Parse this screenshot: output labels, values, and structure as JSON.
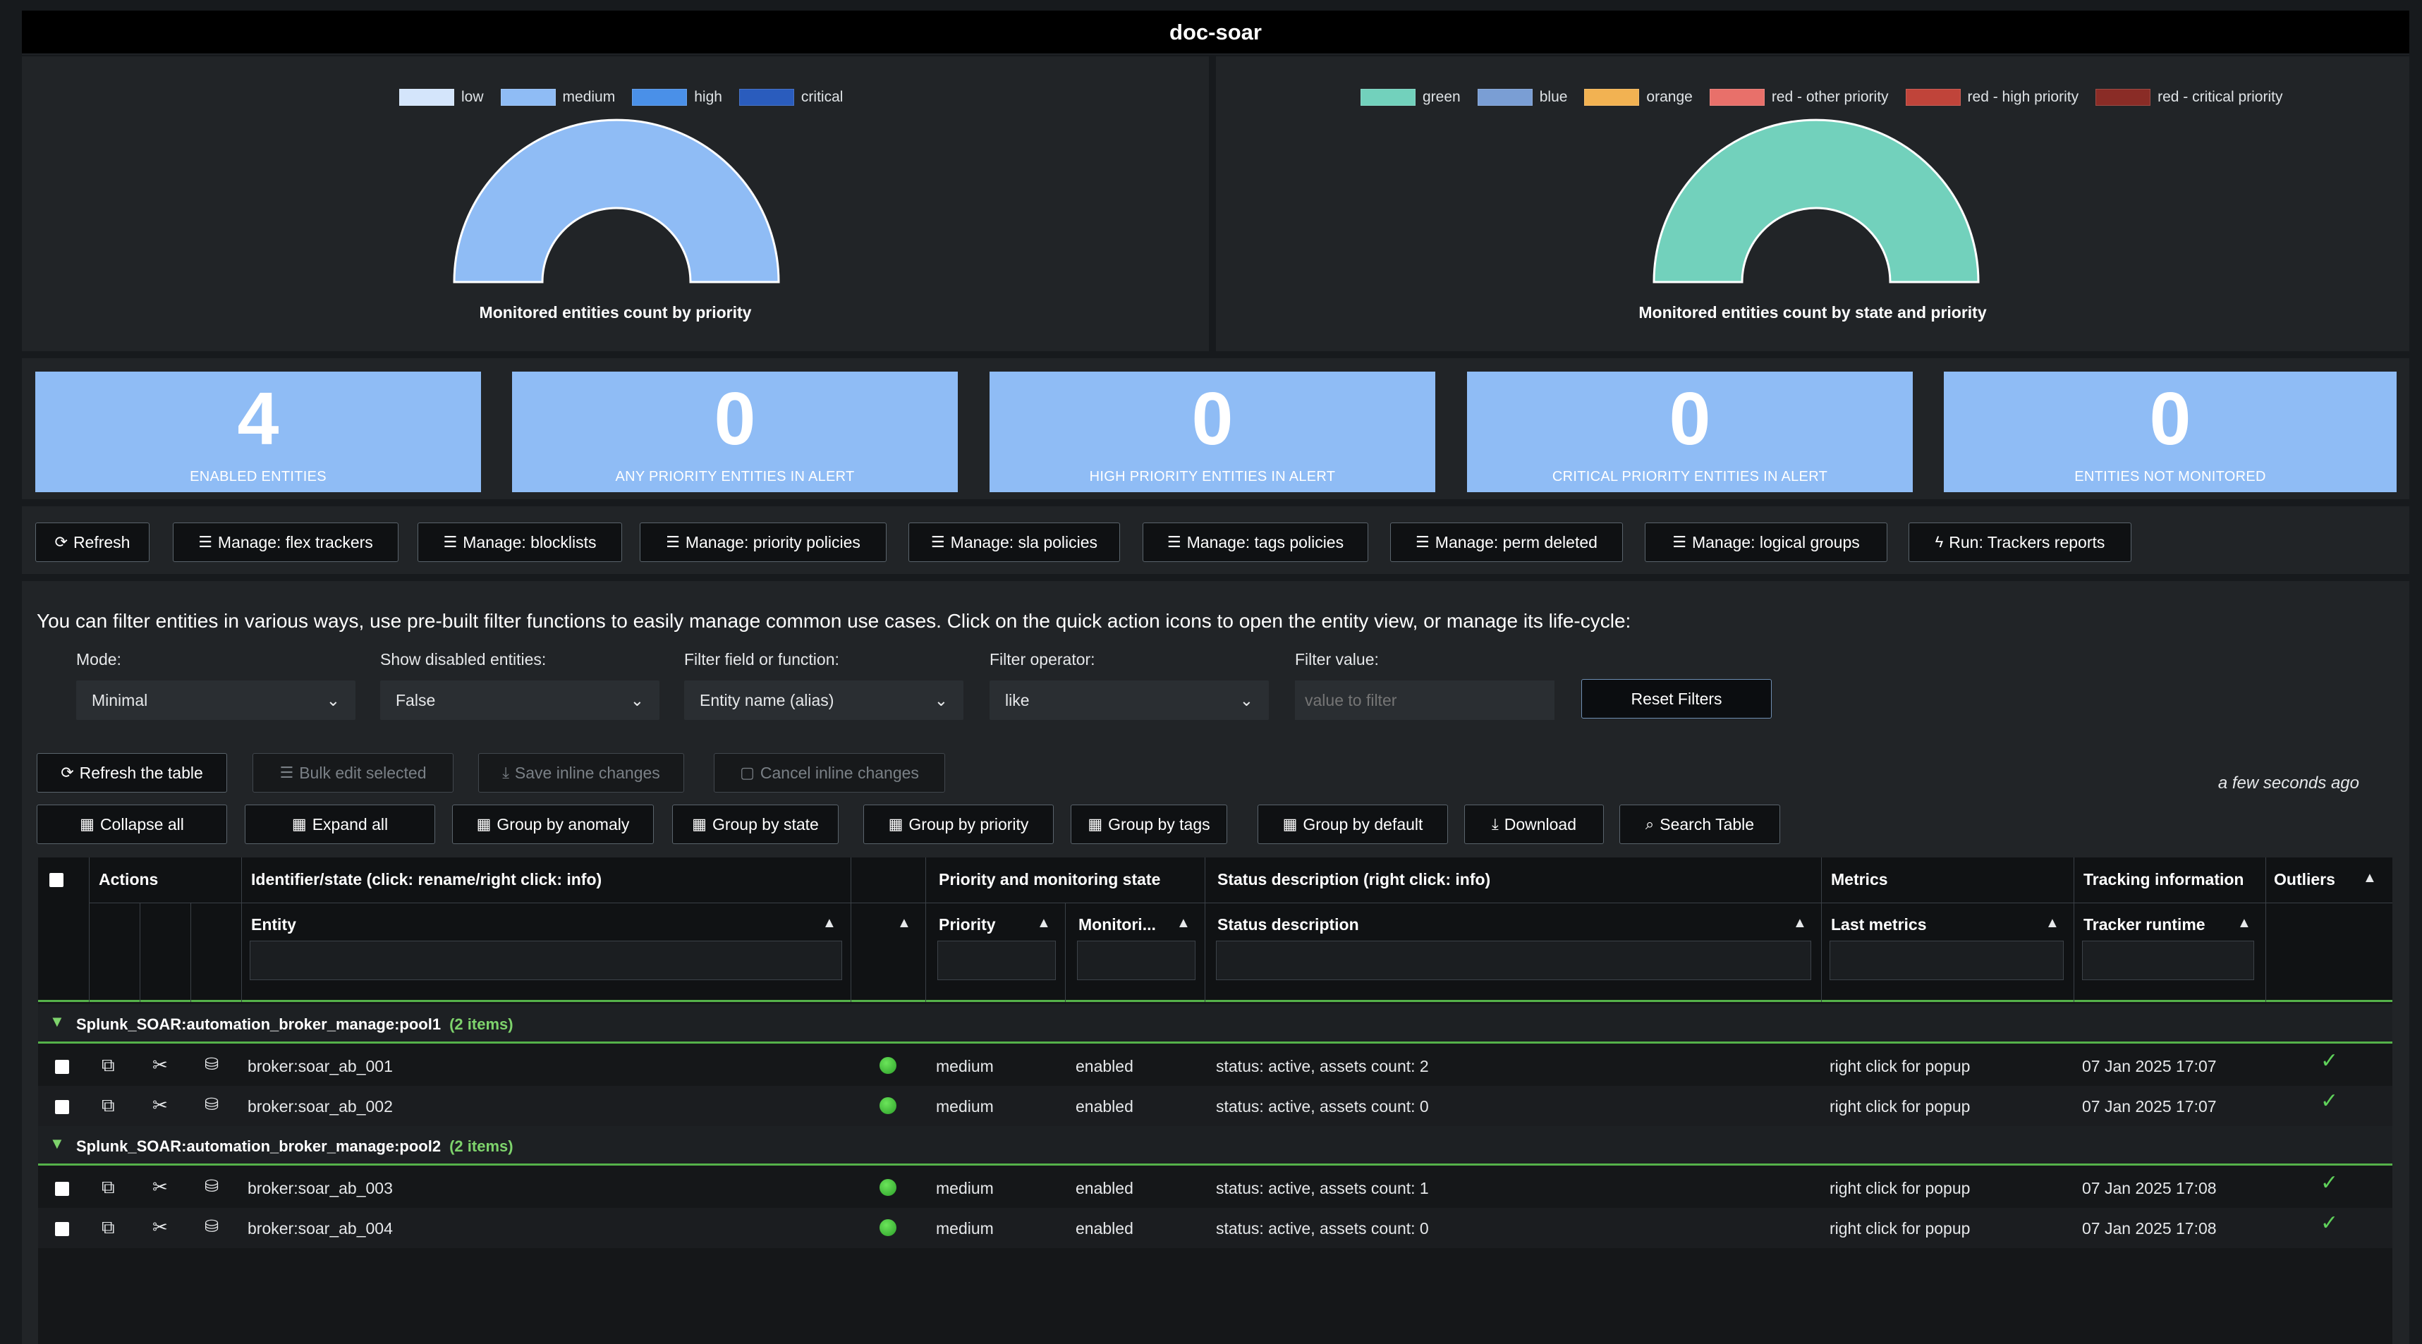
{
  "title": "doc-soar",
  "gauges": [
    {
      "caption": "Monitored entities count by priority",
      "legend": [
        {
          "label": "low",
          "color": "#d4e5fb"
        },
        {
          "label": "medium",
          "color": "#8fbcf5"
        },
        {
          "label": "high",
          "color": "#4a90e8"
        },
        {
          "label": "critical",
          "color": "#2a5cbd"
        }
      ],
      "fill_color": "#8fbcf5"
    },
    {
      "caption": "Monitored entities count by state and priority",
      "legend": [
        {
          "label": "green",
          "color": "#72d1bc"
        },
        {
          "label": "blue",
          "color": "#7a9ed4"
        },
        {
          "label": "orange",
          "color": "#f2b252"
        },
        {
          "label": "red - other priority",
          "color": "#e8706a"
        },
        {
          "label": "red - high priority",
          "color": "#c0443a"
        },
        {
          "label": "red - critical priority",
          "color": "#8a2c26"
        }
      ],
      "fill_color": "#72d1bc"
    }
  ],
  "kpis": [
    {
      "value": "4",
      "label": "ENABLED ENTITIES"
    },
    {
      "value": "0",
      "label": "ANY PRIORITY ENTITIES IN ALERT"
    },
    {
      "value": "0",
      "label": "HIGH PRIORITY ENTITIES IN ALERT"
    },
    {
      "value": "0",
      "label": "CRITICAL PRIORITY ENTITIES IN ALERT"
    },
    {
      "value": "0",
      "label": "ENTITIES NOT MONITORED"
    }
  ],
  "actions": [
    {
      "label": "Refresh",
      "icon": "refresh-icon"
    },
    {
      "label": "Manage: flex trackers",
      "icon": "sliders-icon"
    },
    {
      "label": "Manage: blocklists",
      "icon": "sliders-icon"
    },
    {
      "label": "Manage: priority policies",
      "icon": "sliders-icon"
    },
    {
      "label": "Manage: sla policies",
      "icon": "sliders-icon"
    },
    {
      "label": "Manage: tags policies",
      "icon": "sliders-icon"
    },
    {
      "label": "Manage: perm deleted",
      "icon": "sliders-icon"
    },
    {
      "label": "Manage: logical groups",
      "icon": "sliders-icon"
    },
    {
      "label": "Run: Trackers reports",
      "icon": "bolt-icon"
    }
  ],
  "filters": {
    "intro": "You can filter entities in various ways, use pre-built filter functions to easily manage common use cases. Click on the quick action icons to open the entity view, or manage its life-cycle:",
    "mode_label": "Mode:",
    "mode_value": "Minimal",
    "disabled_label": "Show disabled entities:",
    "disabled_value": "False",
    "field_label": "Filter field or function:",
    "field_value": "Entity name (alias)",
    "operator_label": "Filter operator:",
    "operator_value": "like",
    "value_label": "Filter value:",
    "value_placeholder": "value to filter",
    "reset_label": "Reset Filters"
  },
  "table_toolbar": {
    "refresh": "Refresh the table",
    "bulk_edit": "Bulk edit selected",
    "save_inline": "Save inline changes",
    "cancel_inline": "Cancel inline changes",
    "timestamp": "a few seconds ago",
    "collapse": "Collapse all",
    "expand": "Expand all",
    "group_anomaly": "Group by anomaly",
    "group_state": "Group by state",
    "group_priority": "Group by priority",
    "group_tags": "Group by tags",
    "group_default": "Group by default",
    "download": "Download",
    "search": "Search Table"
  },
  "table": {
    "headers": {
      "actions": "Actions",
      "identifier": "Identifier/state (click: rename/right click: info)",
      "priority_group": "Priority and monitoring state",
      "status_group": "Status description (right click: info)",
      "metrics": "Metrics",
      "tracking": "Tracking information",
      "outliers": "Outliers",
      "entity": "Entity",
      "priority": "Priority",
      "monitoring": "Monitori...",
      "status_desc": "Status description",
      "last_metrics": "Last metrics",
      "tracker_runtime": "Tracker runtime"
    },
    "groups": [
      {
        "name": "Splunk_SOAR:automation_broker_manage:pool1",
        "count": "(2 items)",
        "rows": [
          {
            "entity": "broker:soar_ab_001",
            "priority": "medium",
            "monitoring": "enabled",
            "status": "status: active, assets count: 2",
            "metrics": "right click for popup",
            "runtime": "07 Jan 2025 17:07"
          },
          {
            "entity": "broker:soar_ab_002",
            "priority": "medium",
            "monitoring": "enabled",
            "status": "status: active, assets count: 0",
            "metrics": "right click for popup",
            "runtime": "07 Jan 2025 17:07"
          }
        ]
      },
      {
        "name": "Splunk_SOAR:automation_broker_manage:pool2",
        "count": "(2 items)",
        "rows": [
          {
            "entity": "broker:soar_ab_003",
            "priority": "medium",
            "monitoring": "enabled",
            "status": "status: active, assets count: 1",
            "metrics": "right click for popup",
            "runtime": "07 Jan 2025 17:08"
          },
          {
            "entity": "broker:soar_ab_004",
            "priority": "medium",
            "monitoring": "enabled",
            "status": "status: active, assets count: 0",
            "metrics": "right click for popup",
            "runtime": "07 Jan 2025 17:08"
          }
        ]
      }
    ]
  }
}
